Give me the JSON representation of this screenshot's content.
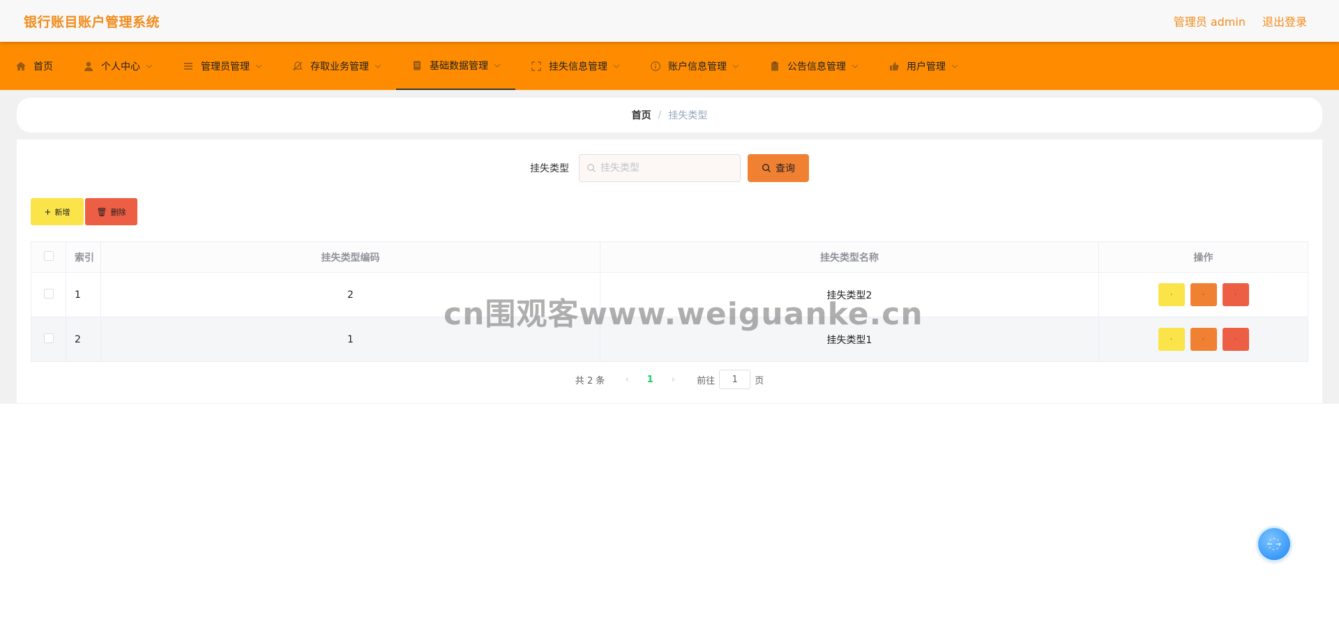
{
  "header": {
    "app_title": "银行账目账户管理系统",
    "user_label": "管理员 admin",
    "logout_label": "退出登录"
  },
  "nav": {
    "items": [
      {
        "label": "首页",
        "icon": "home-icon"
      },
      {
        "label": "个人中心",
        "icon": "user-icon"
      },
      {
        "label": "管理员管理",
        "icon": "list-icon"
      },
      {
        "label": "存取业务管理",
        "icon": "bell-off-icon"
      },
      {
        "label": "基础数据管理",
        "icon": "document-icon"
      },
      {
        "label": "挂失信息管理",
        "icon": "fullscreen-icon"
      },
      {
        "label": "账户信息管理",
        "icon": "info-icon"
      },
      {
        "label": "公告信息管理",
        "icon": "clipboard-icon"
      },
      {
        "label": "用户管理",
        "icon": "thumb-icon"
      }
    ],
    "active_index": 4
  },
  "breadcrumb": {
    "home": "首页",
    "separator": "/",
    "current": "挂失类型"
  },
  "search": {
    "label": "挂失类型",
    "placeholder": "挂失类型",
    "button_label": "查询"
  },
  "actions": {
    "add_label": "新增",
    "delete_label": "删除"
  },
  "table": {
    "columns": [
      "索引",
      "挂失类型编码",
      "挂失类型名称",
      "操作"
    ],
    "rows": [
      {
        "index": "1",
        "code": "2",
        "name": "挂失类型2"
      },
      {
        "index": "2",
        "code": "1",
        "name": "挂失类型1"
      }
    ],
    "row_buttons": [
      "·",
      "·",
      "·"
    ]
  },
  "pagination": {
    "total_label": "共 2 条",
    "current_page": "1",
    "goto_label": "前往",
    "goto_value": "1",
    "page_suffix": "页"
  },
  "watermark": "cn围观客www.weiguanke.cn",
  "colors": {
    "brand": "#ff8c00",
    "title": "#f28c1c",
    "yellow": "#fbe44a",
    "orange": "#f08133",
    "red": "#ec5f44",
    "page_active": "#13ce66"
  }
}
